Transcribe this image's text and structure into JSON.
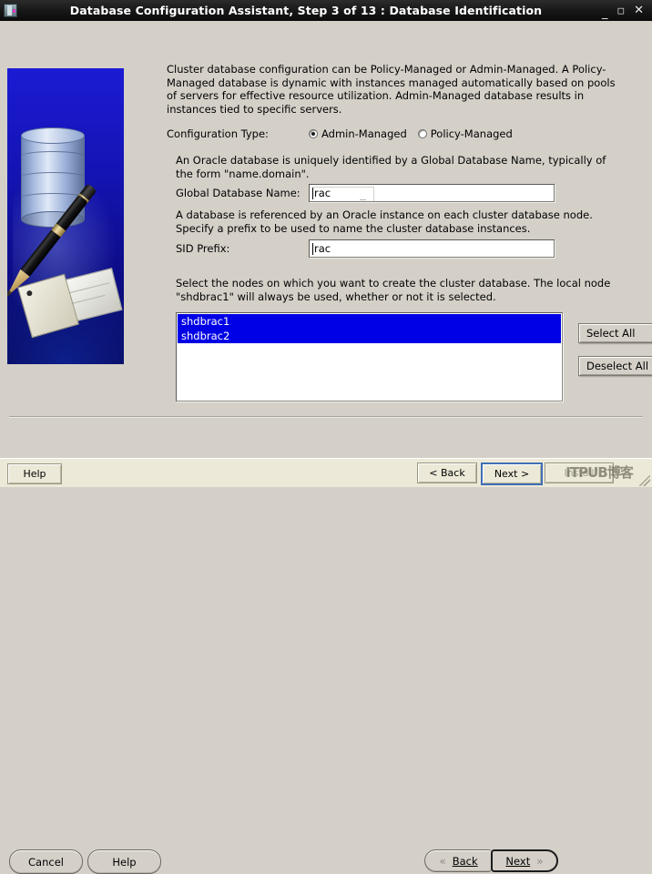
{
  "window": {
    "title": "Database Configuration Assistant, Step 3 of 13 : Database Identification",
    "app_icon": "database-app-icon",
    "minimize": "_",
    "maximize": "□",
    "close": "✕"
  },
  "artwork": {
    "name": "oracle-database-pen-tag-graphic"
  },
  "main": {
    "intro_text": "Cluster database configuration can be Policy-Managed or Admin-Managed. A Policy-Managed database is dynamic with instances managed automatically based on pools of servers for effective resource utilization. Admin-Managed database results in instances tied to specific servers.",
    "config_type_label": "Configuration Type:",
    "config_options": [
      {
        "label": "Admin-Managed",
        "selected": true
      },
      {
        "label": "Policy-Managed",
        "selected": false
      }
    ],
    "global_db_desc": "An Oracle database is uniquely identified by a Global Database Name, typically of the form \"name.domain\".",
    "global_db_label": "Global Database Name:",
    "global_db_value": "rac",
    "sid_desc": "A database is referenced by an Oracle instance on each cluster database node. Specify a prefix to be used to name the cluster database instances.",
    "sid_label": "SID Prefix:",
    "sid_value": "rac",
    "nodes_desc": "Select the nodes on which you want to create the cluster database. The local node \"shdbrac1\" will always be used, whether or not it is selected.",
    "nodes": [
      {
        "label": "shdbrac1",
        "selected": true
      },
      {
        "label": "shdbrac2",
        "selected": true
      }
    ],
    "select_all_label": "Select All",
    "deselect_all_label": "Deselect All"
  },
  "buttons": {
    "cancel": "Cancel",
    "help": "Help",
    "back": "Back",
    "next": "Next",
    "back_chevron": "«",
    "next_chevron": "»"
  },
  "statusbar": {
    "help": "Help",
    "back": "< Back",
    "next": "Next >",
    "install": "Install",
    "watermark": "ITPUB博客"
  },
  "colors": {
    "face": "#d4d0c8",
    "title_bar": "#141414",
    "selection_blue": "#0000e6",
    "status_face": "#ece9d8",
    "focus_blue": "#3f6fb5"
  }
}
